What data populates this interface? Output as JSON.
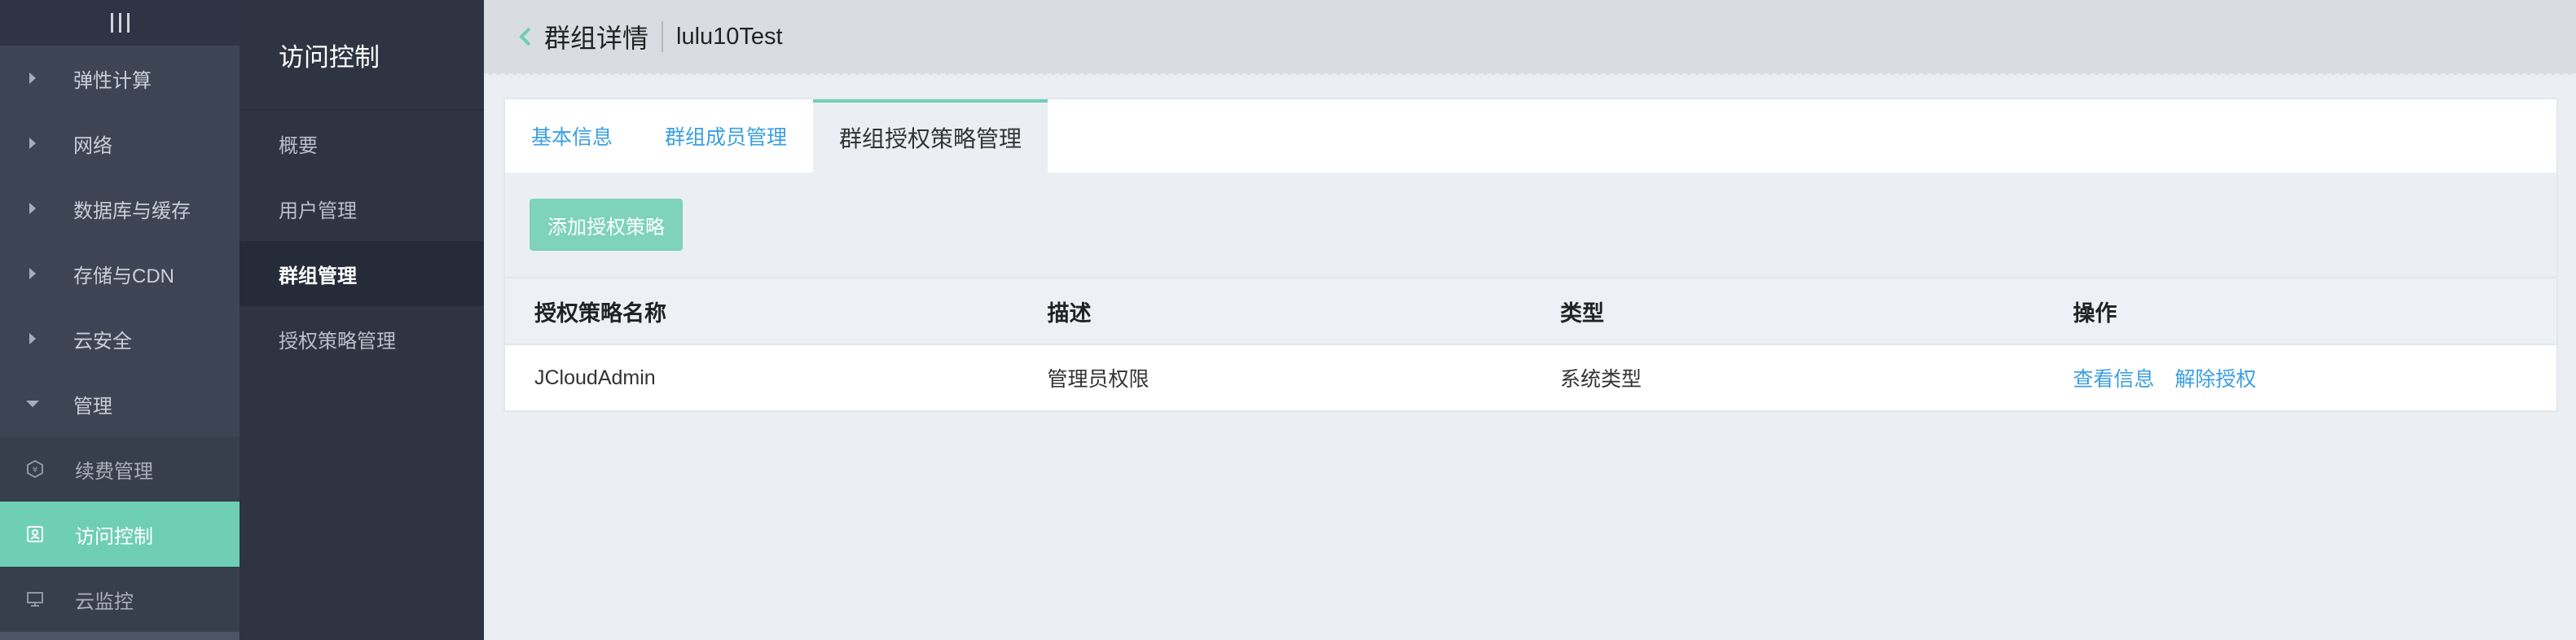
{
  "nav1": {
    "items": [
      {
        "label": "弹性计算"
      },
      {
        "label": "网络"
      },
      {
        "label": "数据库与缓存"
      },
      {
        "label": "存储与CDN"
      },
      {
        "label": "云安全"
      },
      {
        "label": "管理"
      }
    ],
    "subitems": [
      {
        "label": "续费管理",
        "icon": "yen-icon"
      },
      {
        "label": "访问控制",
        "icon": "user-card-icon"
      },
      {
        "label": "云监控",
        "icon": "monitor-icon"
      }
    ]
  },
  "nav2": {
    "title": "访问控制",
    "items": [
      {
        "label": "概要"
      },
      {
        "label": "用户管理"
      },
      {
        "label": "群组管理"
      },
      {
        "label": "授权策略管理"
      }
    ]
  },
  "header": {
    "title": "群组详情",
    "subtitle": "lulu10Test"
  },
  "tabs": [
    {
      "label": "基本信息"
    },
    {
      "label": "群组成员管理"
    },
    {
      "label": "群组授权策略管理"
    }
  ],
  "toolbar": {
    "add_label": "添加授权策略"
  },
  "table": {
    "headers": [
      "授权策略名称",
      "描述",
      "类型",
      "操作"
    ],
    "rows": [
      {
        "name": "JCloudAdmin",
        "desc": "管理员权限",
        "type": "系统类型",
        "actions": [
          "查看信息",
          "解除授权"
        ]
      }
    ]
  },
  "colors": {
    "accent": "#6ecfb4",
    "link": "#3b9fe0"
  }
}
